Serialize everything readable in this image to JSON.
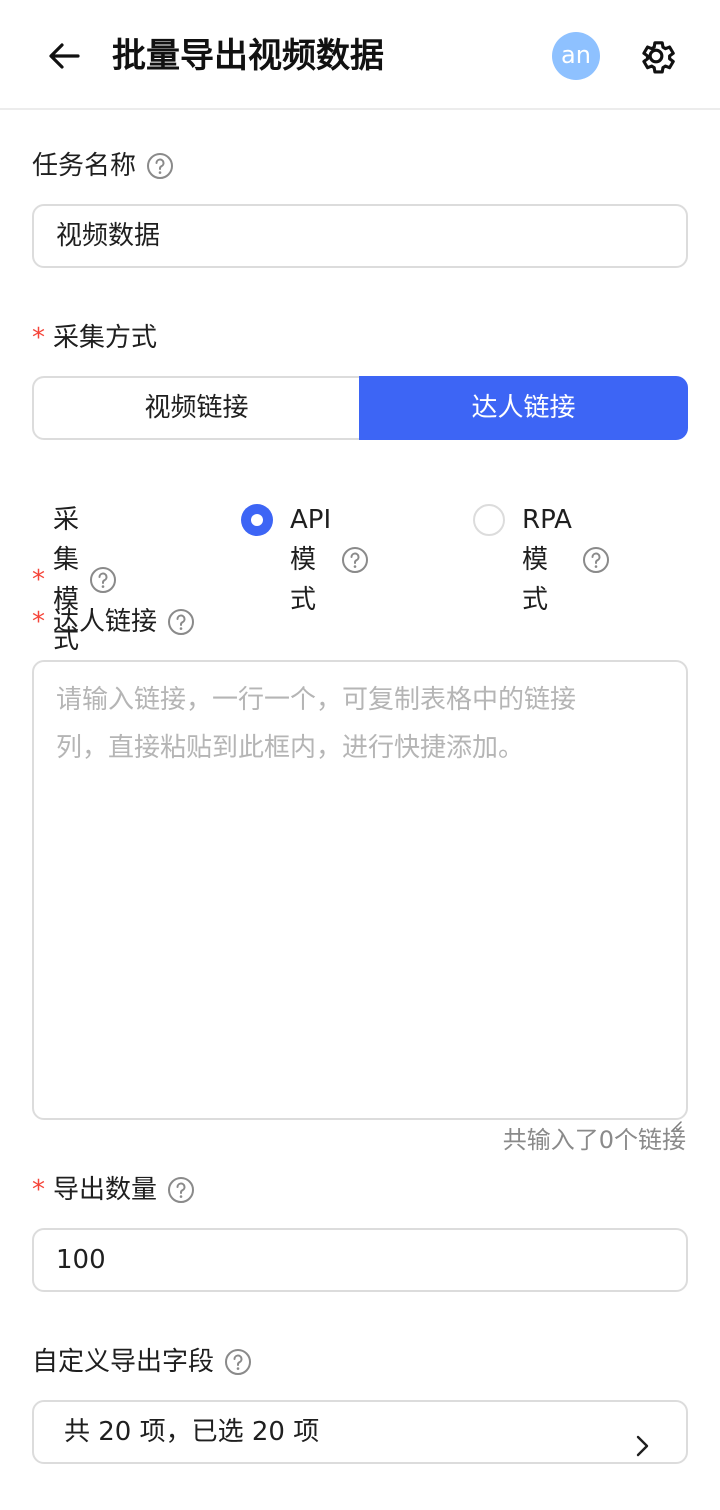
{
  "header": {
    "title": "批量导出视频数据",
    "avatar_text": "an",
    "back_icon": "arrow-left-icon",
    "settings_icon": "gear-icon"
  },
  "task_name": {
    "label": "任务名称",
    "value": "视频数据"
  },
  "collect_method": {
    "label": "采集方式",
    "required": true,
    "options": [
      "视频链接",
      "达人链接"
    ],
    "selected": "达人链接"
  },
  "collect_mode": {
    "label": "采集模式",
    "required": true,
    "options": [
      "API模式",
      "RPA模式"
    ],
    "selected": "API模式"
  },
  "creator_links": {
    "label": "达人链接",
    "required": true,
    "placeholder_line1": "请输入链接，一行一个，可复制表格中的链接",
    "placeholder_line2": "列，直接粘贴到此框内，进行快捷添加。",
    "count_text": "共输入了0个链接"
  },
  "export_count": {
    "label": "导出数量",
    "required": true,
    "value": "100"
  },
  "custom_fields": {
    "label": "自定义导出字段",
    "summary": "共 20 项，已选 20 项"
  },
  "colors": {
    "accent": "#3d65f5",
    "required": "#f5453a",
    "avatar": "#8ec1ff"
  }
}
